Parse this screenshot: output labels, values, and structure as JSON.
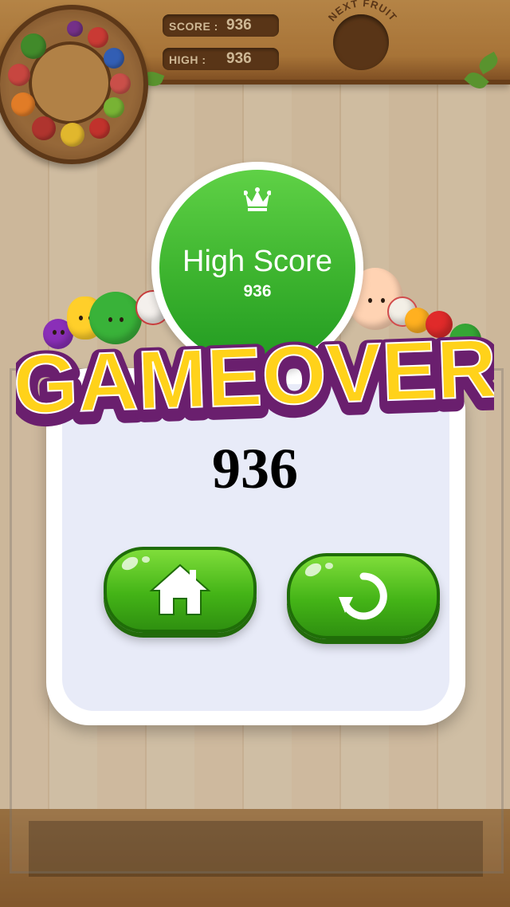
{
  "header": {
    "score_label": "SCORE :",
    "score_value": "936",
    "high_label": "HIGH :",
    "high_value": "936",
    "next_fruit_label": "NEXT FRUIT"
  },
  "high_score_badge": {
    "title": "High Score",
    "value": "936",
    "icon": "crown-icon"
  },
  "game_over": {
    "title": "GAMEOVER",
    "final_score": "936"
  },
  "buttons": {
    "home_icon": "home-icon",
    "restart_icon": "restart-icon"
  },
  "colors": {
    "button_green": "#44b417",
    "title_yellow": "#ffd21a",
    "title_outline": "#6a1f6e",
    "badge_green": "#3cb32e"
  }
}
